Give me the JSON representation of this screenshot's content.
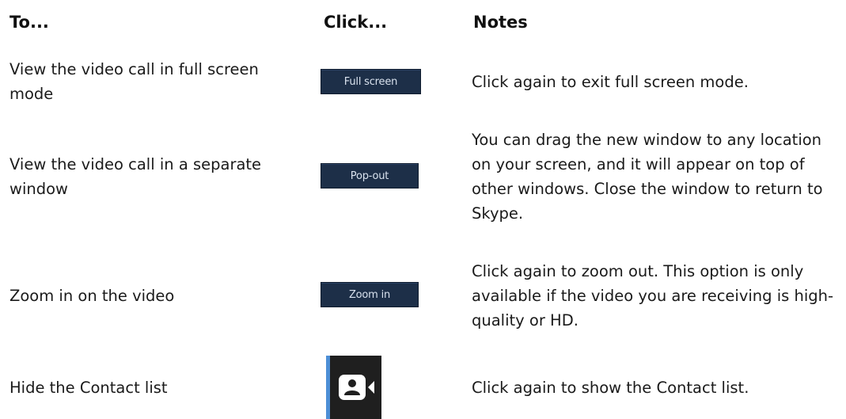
{
  "headers": {
    "to": "To...",
    "click": "Click...",
    "notes": "Notes"
  },
  "rows": [
    {
      "to": "View the video call in full screen mode",
      "click_label": "Full screen",
      "notes": "Click again to exit full screen mode."
    },
    {
      "to": "View the video call in a separate window",
      "click_label": "Pop-out",
      "notes": "You can drag the new window to any location on your screen, and it will appear on top of other windows. Close the window to return to Skype."
    },
    {
      "to": "Zoom in on the video",
      "click_label": "Zoom in",
      "notes": "Click again to zoom out. This option is only available if the video you are receiving is high-quality or HD."
    },
    {
      "to": "Hide the Contact list",
      "click_icon": "contact-list-toggle-icon",
      "notes": "Click again to show the Contact list."
    }
  ],
  "colors": {
    "button_bg": "#1d2f48",
    "button_text": "#d9e2ee",
    "toggle_bg": "#1f1f1f",
    "toggle_edge": "#4d8fd6"
  }
}
